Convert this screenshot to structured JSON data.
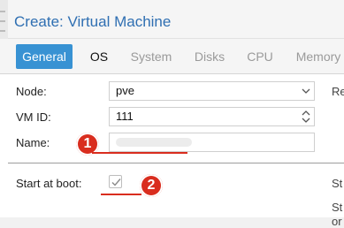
{
  "window": {
    "title": "Create: Virtual Machine"
  },
  "tabs": [
    {
      "label": "General",
      "state": "active"
    },
    {
      "label": "OS",
      "state": "enabled"
    },
    {
      "label": "System",
      "state": "disabled"
    },
    {
      "label": "Disks",
      "state": "disabled"
    },
    {
      "label": "CPU",
      "state": "disabled"
    },
    {
      "label": "Memory",
      "state": "disabled"
    }
  ],
  "form": {
    "node_label": "Node:",
    "node_value": "pve",
    "vmid_label": "VM ID:",
    "vmid_value": "111",
    "name_label": "Name:",
    "name_value_redacted": true,
    "start_at_boot_label": "Start at boot:",
    "start_at_boot_checked": true
  },
  "right_column_cutoff": {
    "row1": "Re",
    "row2": "St",
    "row3": "or",
    "row4": "St"
  },
  "annotations": [
    {
      "number": "1"
    },
    {
      "number": "2"
    }
  ],
  "colors": {
    "accent": "#3892d3",
    "title": "#2f6fb2",
    "annotation": "#d92d1e"
  }
}
